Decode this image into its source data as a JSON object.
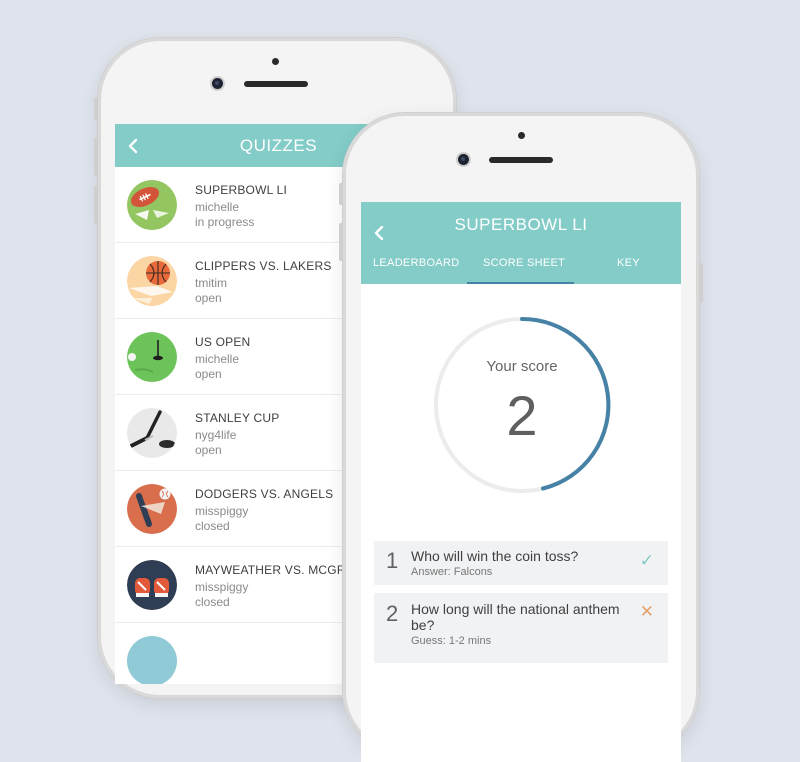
{
  "quizzes_screen": {
    "title": "QUIZZES",
    "items": [
      {
        "name": "SUPERBOWL LI",
        "user": "michelle",
        "status": "in progress",
        "icon": "football-icon"
      },
      {
        "name": "CLIPPERS VS. LAKERS",
        "user": "tmitim",
        "status": "open",
        "icon": "basketball-icon"
      },
      {
        "name": "US OPEN",
        "user": "michelle",
        "status": "open",
        "icon": "golf-icon"
      },
      {
        "name": "STANLEY CUP",
        "user": "nyg4life",
        "status": "open",
        "icon": "hockey-icon"
      },
      {
        "name": "DODGERS VS. ANGELS",
        "user": "misspiggy",
        "status": "closed",
        "icon": "baseball-icon"
      },
      {
        "name": "MAYWEATHER VS. MCGREGOR",
        "user": "misspiggy",
        "status": "closed",
        "icon": "boxing-icon"
      }
    ]
  },
  "scoresheet_screen": {
    "title": "SUPERBOWL LI",
    "tabs": [
      "LEADERBOARD",
      "SCORE SHEET",
      "KEY"
    ],
    "active_tab": "SCORE SHEET",
    "score_label": "Your score",
    "score_value": "2",
    "questions": [
      {
        "num": "1",
        "text": "Who will win the coin toss?",
        "answer": "Answer: Falcons",
        "result": "✓"
      },
      {
        "num": "2",
        "text": "How long will the national anthem be?",
        "answer": "Guess: 1-2 mins",
        "result": "✕"
      }
    ]
  },
  "colors": {
    "header": "#83ccc7",
    "active_tab_underline": "#4682a5",
    "score_ring": "#4682a5",
    "correct": "#83ccc7",
    "incorrect": "#e8a36b",
    "background": "#dfe3ec"
  }
}
